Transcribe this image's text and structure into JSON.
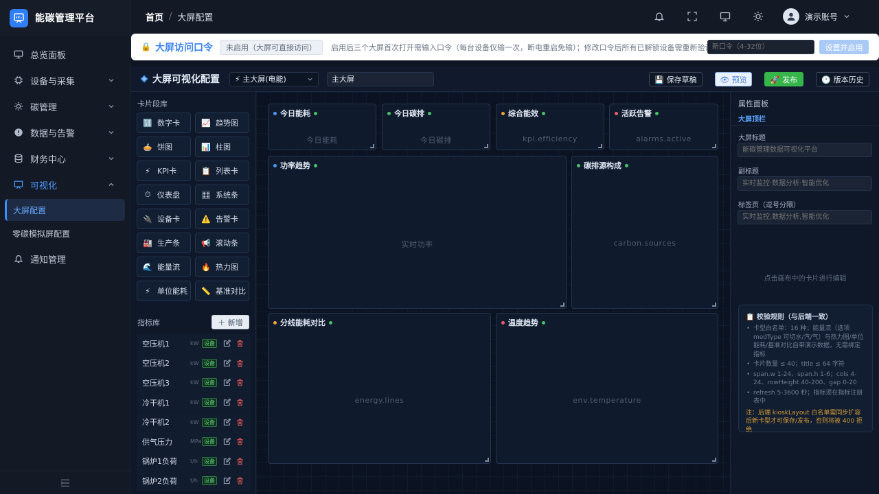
{
  "brand": {
    "name": "能碳管理平台"
  },
  "sidebar": {
    "items": [
      {
        "label": "总览面板",
        "icon": "monitor-icon"
      },
      {
        "label": "设备与采集",
        "icon": "chip-icon"
      },
      {
        "label": "碳管理",
        "icon": "sun-icon"
      },
      {
        "label": "数据与告警",
        "icon": "alert-circle-icon"
      },
      {
        "label": "财务中心",
        "icon": "database-icon"
      },
      {
        "label": "可视化",
        "icon": "chart-screen-icon"
      }
    ],
    "sub_items": [
      {
        "label": "大屏配置"
      },
      {
        "label": "零碳模拟屏配置"
      }
    ],
    "last_item": {
      "label": "通知管理",
      "icon": "bell-icon"
    }
  },
  "header": {
    "breadcrumb": {
      "home": "首页",
      "separator": "/",
      "current": "大屏配置"
    },
    "user": {
      "name": "演示账号"
    }
  },
  "banner": {
    "lock_icon": "🔒",
    "title": "大屏访问口令",
    "badge": "未启用（大屏可直接访问）",
    "description": "启用后三个大屏首次打开需输入口令（每台设备仅输一次，断电重启免输）；修改口令后所有已解锁设备需重新验证",
    "input_placeholder": "新口令（4-32位）",
    "button": "设置并启用"
  },
  "workspace": {
    "title": "大屏可视化配置",
    "screen_select": "⚡ 主大屏(电能)",
    "screen_name": "主大屏",
    "buttons": {
      "save": "💾 保存草稿",
      "preview": "👁 预览",
      "publish": "🚀 发布",
      "history": "🕐 版本历史"
    }
  },
  "library": {
    "cards_heading": "卡片段库",
    "cards": [
      {
        "emoji": "🔢",
        "label": "数字卡"
      },
      {
        "emoji": "📈",
        "label": "趋势图"
      },
      {
        "emoji": "🥧",
        "label": "饼图"
      },
      {
        "emoji": "📊",
        "label": "柱图"
      },
      {
        "emoji": "⚡",
        "label": "KPI卡"
      },
      {
        "emoji": "📋",
        "label": "列表卡"
      },
      {
        "emoji": "⏱",
        "label": "仪表盘"
      },
      {
        "emoji": "🎛",
        "label": "系统条"
      },
      {
        "emoji": "🔌",
        "label": "设备卡"
      },
      {
        "emoji": "⚠️",
        "label": "告警卡"
      },
      {
        "emoji": "🏭",
        "label": "生产条"
      },
      {
        "emoji": "📢",
        "label": "滚动条"
      },
      {
        "emoji": "🌊",
        "label": "能量流"
      },
      {
        "emoji": "🔥",
        "label": "热力图"
      },
      {
        "emoji": "⚡",
        "label": "单位能耗"
      },
      {
        "emoji": "📏",
        "label": "基准对比"
      }
    ],
    "metrics_heading": "指标库",
    "add_button": "＋ 新增",
    "metrics": [
      {
        "name": "空压机1",
        "unit": "kW",
        "tag": "设备"
      },
      {
        "name": "空压机2",
        "unit": "kW",
        "tag": "设备"
      },
      {
        "name": "空压机3",
        "unit": "kW",
        "tag": "设备"
      },
      {
        "name": "冷干机1",
        "unit": "kW",
        "tag": "设备"
      },
      {
        "name": "冷干机2",
        "unit": "kW",
        "tag": "设备"
      },
      {
        "name": "供气压力",
        "unit": "MPa",
        "tag": "设备"
      },
      {
        "name": "锅炉1负荷",
        "unit": "t/h",
        "tag": "设备"
      },
      {
        "name": "锅炉2负荷",
        "unit": "t/h",
        "tag": "设备"
      }
    ]
  },
  "canvas": {
    "cards": [
      {
        "title": "今日能耗",
        "bind": "今日能耗",
        "dot": "blue"
      },
      {
        "title": "今日碳排",
        "bind": "今日碳排",
        "dot": "green"
      },
      {
        "title": "综合能效",
        "bind": "kpi.efficiency",
        "dot": "orange"
      },
      {
        "title": "活跃告警",
        "bind": "alarms.active",
        "dot": "red"
      },
      {
        "title": "功率趋势",
        "bind": "实时功率",
        "dot": "blue"
      },
      {
        "title": "碳排源构成",
        "bind": "carbon.sources",
        "dot": "green"
      },
      {
        "title": "分线能耗对比",
        "bind": "energy.lines",
        "dot": "orange"
      },
      {
        "title": "温度趋势",
        "bind": "env.temperature",
        "dot": "red"
      }
    ]
  },
  "props": {
    "heading": "属性面板",
    "section": "大屏顶栏",
    "fields": [
      {
        "label": "大屏标题",
        "placeholder": "能碳管理数据可视化平台"
      },
      {
        "label": "副标题",
        "placeholder": "实时监控·数据分析·智能优化"
      },
      {
        "label": "标签页（逗号分隔）",
        "placeholder": "实时监控,数据分析,智能优化"
      }
    ],
    "hint": "点击画布中的卡片进行编辑",
    "rules": {
      "title": "📋 校验规则（与后端一致）",
      "items": [
        "卡型白名单：16 种；能量流（选项 medType 可切水/汽/气）与热力图/单位能耗/基准对比自带演示数据，无需绑定指标",
        "卡片数量 ≤ 40；title ≤ 64 字符",
        "span.w 1-24、span.h 1-6；cols 4-24、rowHeight 40-200、gap 0-20",
        "refresh 5-3600 秒；指标须在指标注册表中"
      ],
      "note": "注：后端 kioskLayout 白名单需同步扩容后新卡型才可保存/发布，否则将被 400 拒绝"
    }
  },
  "colors": {
    "accent": "#3c8dff",
    "publish": "#35b54a",
    "danger": "#e35959",
    "warning": "#d49a35"
  }
}
